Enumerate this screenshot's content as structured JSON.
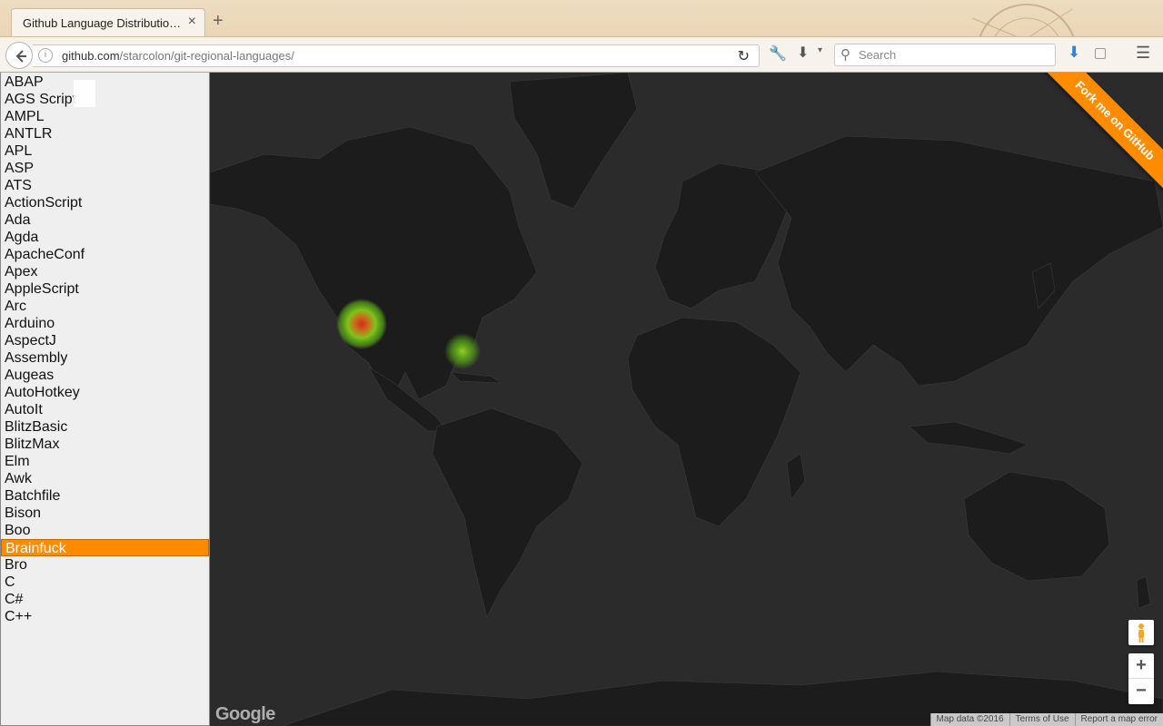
{
  "browser": {
    "tab_title": "Github Language Distribution O...",
    "tab_close": "×",
    "new_tab": "+",
    "url_host": "github.com",
    "url_path": "/starcolon/git-regional-languages/",
    "search_placeholder": "Search",
    "info_icon": "i",
    "reload_icon": "↻",
    "wrench_icon": "🔧",
    "download_icon": "⬇",
    "dropdown_icon": "▾",
    "search_icon": "⚲",
    "menu_icon": "☰"
  },
  "languages": {
    "items": [
      "ABAP",
      "AGS Script",
      "AMPL",
      "ANTLR",
      "APL",
      "ASP",
      "ATS",
      "ActionScript",
      "Ada",
      "Agda",
      "ApacheConf",
      "Apex",
      "AppleScript",
      "Arc",
      "Arduino",
      "AspectJ",
      "Assembly",
      "Augeas",
      "AutoHotkey",
      "AutoIt",
      "BlitzBasic",
      "BlitzMax",
      "Elm",
      "Awk",
      "Batchfile",
      "Bison",
      "Boo",
      "Brainfuck",
      "Bro",
      "C",
      "C#",
      "C++"
    ],
    "selected": "Brainfuck"
  },
  "map": {
    "google_logo": "Google",
    "footer": {
      "map_data": "Map data ©2016",
      "terms": "Terms of Use",
      "report": "Report a map error"
    },
    "zoom_in": "+",
    "zoom_out": "−",
    "fork_ribbon": "Fork me on GitHub",
    "heat_spots": [
      {
        "location": "California",
        "intensity": "high"
      },
      {
        "location": "Florida",
        "intensity": "low"
      }
    ]
  },
  "colors": {
    "accent": "#ff8c00",
    "map_background": "#2b2b2b",
    "land": "#1d1d1d"
  }
}
